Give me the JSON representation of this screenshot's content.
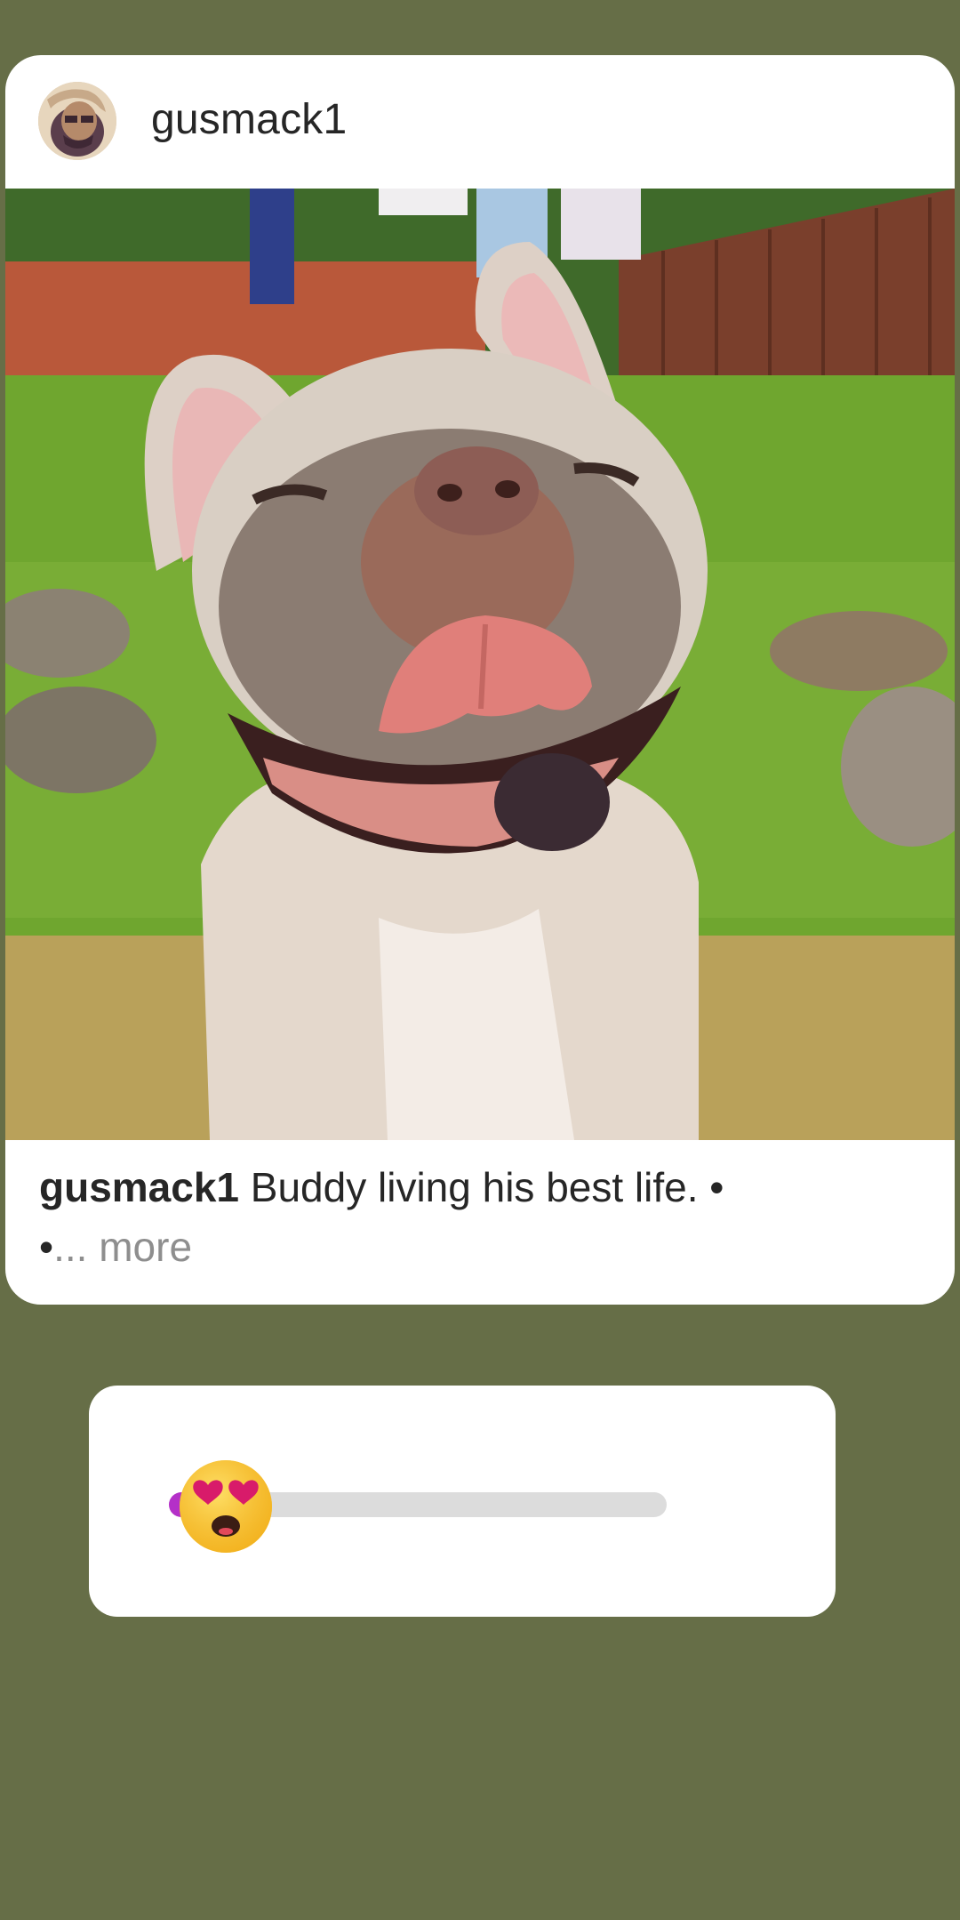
{
  "post": {
    "username": "gusmack1",
    "caption_user": "gusmack1",
    "caption_text": " Buddy living his best life. •",
    "caption_line2": "•",
    "more_label": "... more",
    "photo_subject": "French bulldog smiling with tongue out in garden"
  },
  "slider": {
    "emoji": "smiling-face-with-heart-eyes",
    "value": 0.02,
    "fill_color": "#b430c8",
    "track_color": "#dcdcdc"
  },
  "colors": {
    "background": "#666e47",
    "card": "#ffffff",
    "text": "#262626",
    "muted": "#8e8e8e"
  }
}
